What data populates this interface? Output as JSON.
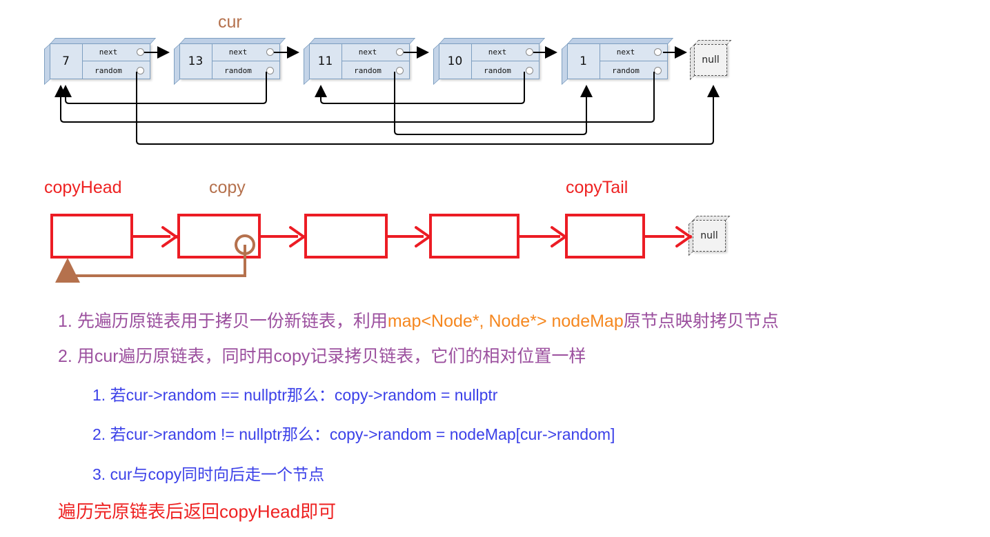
{
  "diagram": {
    "title_labels": {
      "cur": "cur",
      "copy": "copy",
      "copy_head": "copyHead",
      "copy_tail": "copyTail"
    },
    "colors": {
      "node_fill": "#dbe5f1",
      "node_stroke": "#7d9ec0",
      "copy_box_stroke": "#ec1c24",
      "pointer_brown": "#b5714d",
      "text_purple": "#9b4f9e",
      "text_orange": "#f5871f",
      "text_blue": "#3b40e8",
      "text_red": "#ee2222"
    },
    "original_list": {
      "field_labels": {
        "next": "next",
        "random": "random"
      },
      "nodes": [
        {
          "value": "7",
          "next": "13",
          "random": "null"
        },
        {
          "value": "13",
          "next": "11",
          "random": "7"
        },
        {
          "value": "11",
          "next": "10",
          "random": "1"
        },
        {
          "value": "10",
          "next": "1",
          "random": "11"
        },
        {
          "value": "1",
          "next": "null",
          "random": "7"
        }
      ],
      "terminator": "null"
    },
    "copy_list": {
      "node_count": 5,
      "terminator": "null",
      "head_label": "copyHead",
      "tail_label": "copyTail",
      "cursor_label": "copy",
      "random_link": "copy node 2 random -> copy node 1"
    }
  },
  "steps": {
    "item1": {
      "number": "1.",
      "text_a": "先遍历原链表用于拷贝一份新链表，利用",
      "code": "map<Node*, Node*> nodeMap",
      "text_b": "原节点映射拷贝节点"
    },
    "item2": {
      "number": "2.",
      "text": "用cur遍历原链表，同时用copy记录拷贝链表，它们的相对位置一样"
    },
    "sub1": {
      "number": "1.",
      "text": "若cur->random == nullptr那么：copy->random = nullptr"
    },
    "sub2": {
      "number": "2.",
      "text": "若cur->random != nullptr那么：copy->random = nodeMap[cur->random]"
    },
    "sub3": {
      "number": "3.",
      "text": "cur与copy同时向后走一个节点"
    },
    "final": "遍历完原链表后返回copyHead即可"
  }
}
